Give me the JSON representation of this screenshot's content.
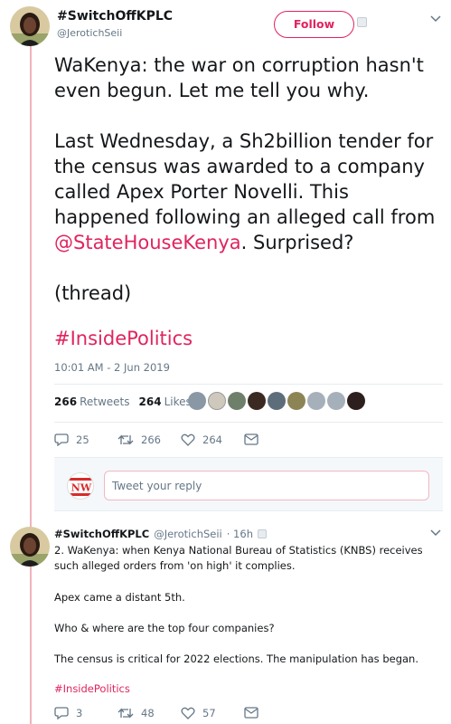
{
  "tweet": {
    "author_name": "#SwitchOffKPLC",
    "author_handle": "@JerotichSeii",
    "follow_label": "Follow",
    "body_part1": "WaKenya: the war on corruption hasn't even begun. Let me tell you why.\n\nLast Wednesday, a Sh2billion tender for the census was awarded to a company called Apex Porter Novelli. This happened following an alleged call from ",
    "mention": "@StateHouseKenya",
    "body_part2": ". Surprised?\n\n(thread)",
    "hashtag": "#InsidePolitics",
    "timestamp": "10:01 AM - 2 Jun 2019",
    "retweets_count": "266",
    "retweets_label": "Retweets",
    "likes_count": "264",
    "likes_label": "Likes",
    "replies": "25",
    "retweets": "266",
    "likes": "264"
  },
  "reply_box": {
    "placeholder": "Tweet your reply",
    "logo_text": "NW"
  },
  "reply_tweet": {
    "author_name": "#SwitchOffKPLC",
    "author_handle": "@JerotichSeii",
    "time": "· 16h",
    "line1": "2. WaKenya: when Kenya National Bureau of Statistics (KNBS) receives such alleged orders from 'on high' it complies.",
    "line2": "Apex came a distant 5th.",
    "line3": "Who & where are the top four companies?",
    "line4": "The census is critical for 2022 elections. The manipulation has began.",
    "hashtag": "#InsidePolitics",
    "replies": "3",
    "retweets": "48",
    "likes": "57"
  },
  "colors": {
    "accent": "#e0245e",
    "thread_line": "#f0b3bb",
    "muted": "#657786"
  }
}
